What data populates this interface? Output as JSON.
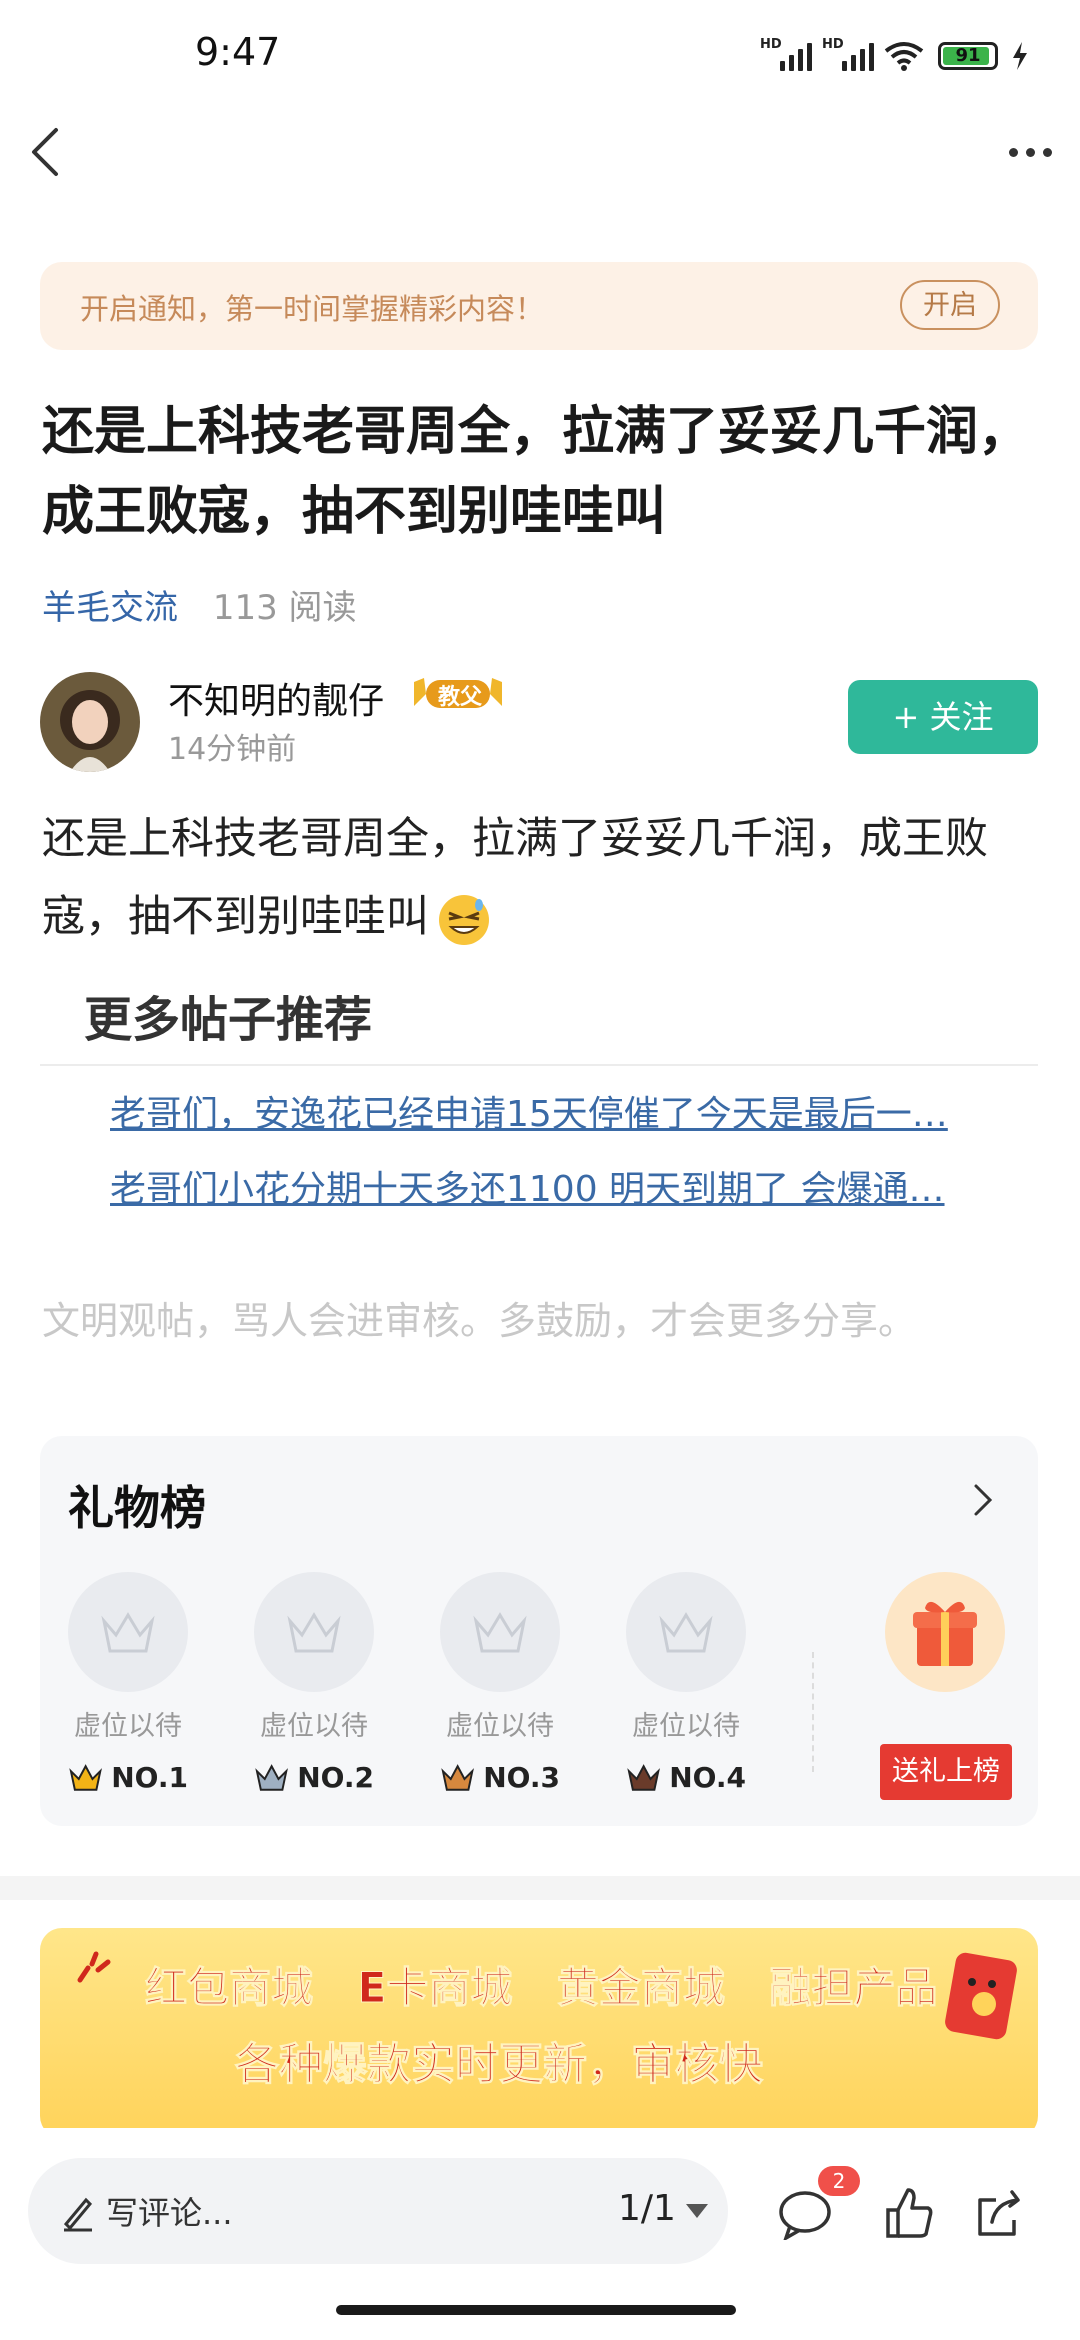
{
  "status_bar": {
    "time": "9:47",
    "battery": "91",
    "signal_label": "HD"
  },
  "banner": {
    "text": "开启通知，第一时间掌握精彩内容！",
    "button": "开启"
  },
  "post": {
    "title": "还是上科技老哥周全，拉满了妥妥几千润，成王败寇，抽不到别哇哇叫",
    "category": "羊毛交流",
    "reads": "113 阅读",
    "body": "还是上科技老哥周全，拉满了妥妥几千润，成王败寇，抽不到别哇哇叫"
  },
  "author": {
    "name": "不知明的靓仔",
    "badge": "教父",
    "time": "14分钟前",
    "follow": "+ 关注"
  },
  "more_posts": {
    "title": "更多帖子推荐",
    "links": [
      "老哥们，安逸花已经申请15天停催了今天是最后一…",
      "老哥们小花分期十天多还1100 明天到期了 会爆通…"
    ]
  },
  "civil_notice": "文明观帖，骂人会进审核。多鼓励，才会更多分享。",
  "gift_board": {
    "title": "礼物榜",
    "slots": [
      {
        "label": "虚位以待",
        "rank": "NO.1",
        "crown": "#f2b316"
      },
      {
        "label": "虚位以待",
        "rank": "NO.2",
        "crown": "#9fb0c2"
      },
      {
        "label": "虚位以待",
        "rank": "NO.3",
        "crown": "#d6883e"
      },
      {
        "label": "虚位以待",
        "rank": "NO.4",
        "crown": "#6a3b2a"
      }
    ],
    "send_button": "送礼上榜"
  },
  "promo": {
    "line1": "红包商城 E卡商城 黄金商城 融担产品",
    "line2": "各种爆款实时更新，审核快"
  },
  "bottom_bar": {
    "comment_placeholder": "写评论...",
    "page": "1/1",
    "message_count": "2"
  },
  "colors": {
    "accent": "#2fb89a",
    "link": "#3a6aa6",
    "badge_red": "#f0504a"
  }
}
